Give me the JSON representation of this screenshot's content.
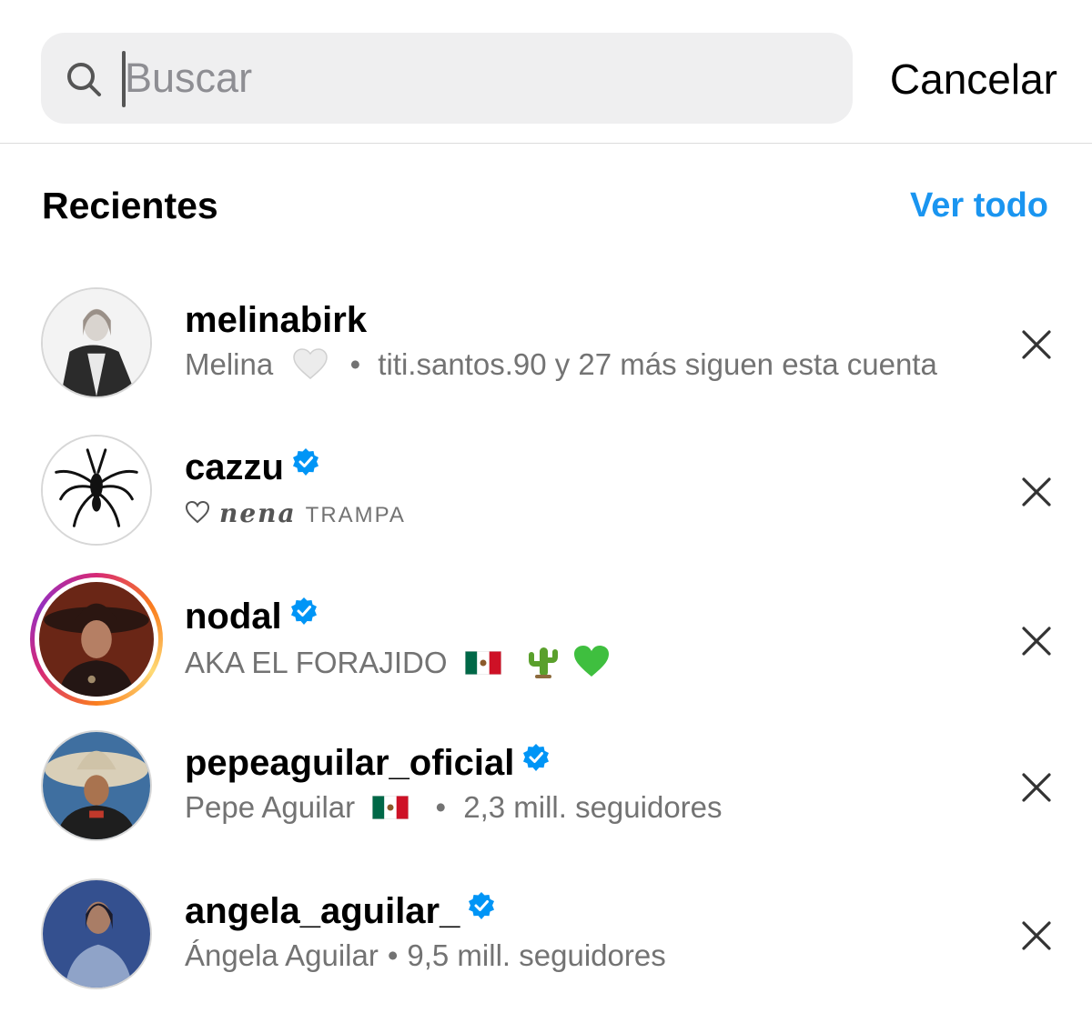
{
  "search": {
    "placeholder": "Buscar",
    "cancel_label": "Cancelar"
  },
  "recents": {
    "title": "Recientes",
    "see_all_label": "Ver todo"
  },
  "accounts": [
    {
      "username": "melinabirk",
      "verified": false,
      "name": "Melina",
      "subtitle_emoji": "white-heart",
      "detail": "titi.santos.90 y 27 más siguen esta cuenta"
    },
    {
      "username": "cazzu",
      "verified": true,
      "bio_word": "nena",
      "bio_word2": "TRAMPA",
      "subtitle_emoji": "outline-heart"
    },
    {
      "username": "nodal",
      "verified": true,
      "bio": "AKA EL FORAJIDO",
      "subtitle_emoji": "mexico-flag cactus green-heart",
      "has_story": true
    },
    {
      "username": "pepeaguilar_oficial",
      "verified": true,
      "name": "Pepe Aguilar",
      "subtitle_emoji": "mexico-flag",
      "detail": "2,3 mill. seguidores"
    },
    {
      "username": "angela_aguilar_",
      "verified": true,
      "name": "Ángela Aguilar",
      "detail": "9,5 mill. seguidores"
    }
  ],
  "separator": "•",
  "colors": {
    "link_blue": "#1a95f0",
    "verified_blue": "#0095f6",
    "secondary_text": "#737373",
    "search_bg": "#efeff0"
  }
}
